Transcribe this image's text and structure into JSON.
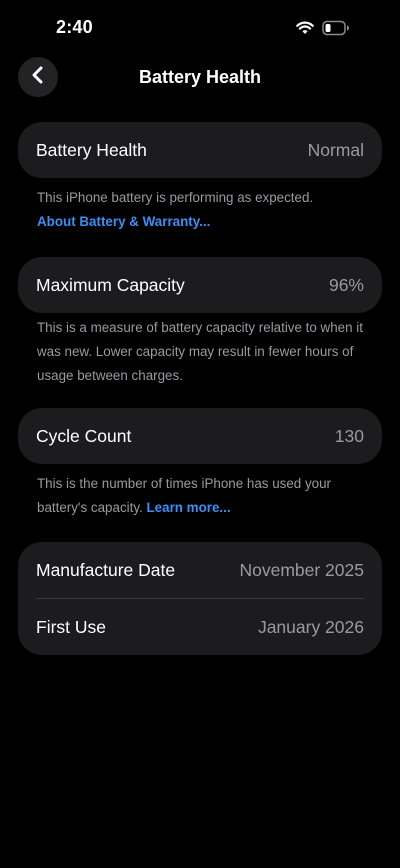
{
  "status_bar": {
    "time": "2:40",
    "wifi_icon": "wifi-icon",
    "battery_icon": "battery-low-icon"
  },
  "nav": {
    "back_icon": "chevron-left-icon",
    "title": "Battery Health"
  },
  "battery_health": {
    "label": "Battery Health",
    "value": "Normal",
    "footer_text": "This iPhone battery is performing as expected.",
    "footer_link": "About Battery & Warranty..."
  },
  "maximum_capacity": {
    "label": "Maximum Capacity",
    "value": "96%",
    "footer_text": "This is a measure of battery capacity relative to when it was new. Lower capacity may result in fewer hours of usage between charges."
  },
  "cycle_count": {
    "label": "Cycle Count",
    "value": "130",
    "footer_text": "This is the number of times iPhone has used your battery's capacity.",
    "footer_link": "Learn more..."
  },
  "dates": {
    "manufacture_label": "Manufacture Date",
    "manufacture_value": "November 2025",
    "first_use_label": "First Use",
    "first_use_value": "January 2026"
  },
  "colors": {
    "background": "#000000",
    "card": "#1c1c1e",
    "secondary_text": "#9a9a9f",
    "link": "#3f8ef5"
  }
}
